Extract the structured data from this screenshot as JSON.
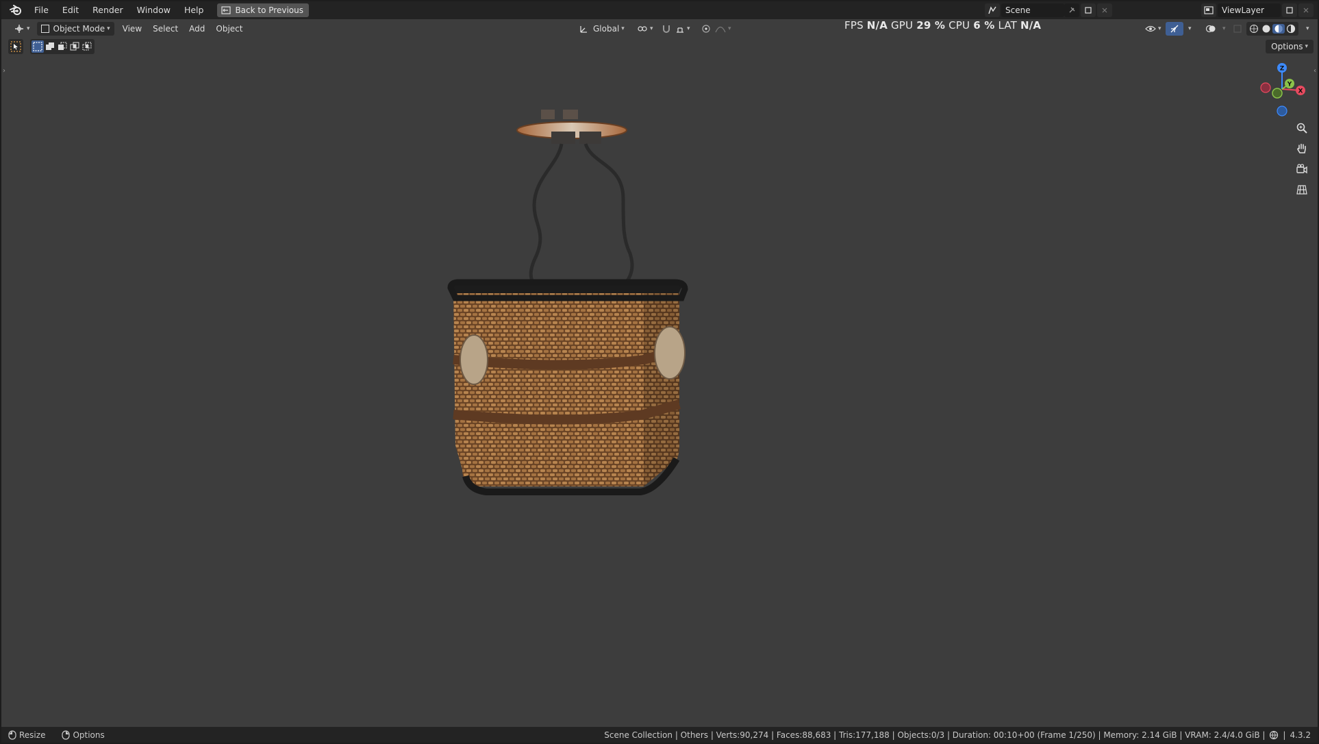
{
  "menu": {
    "items": [
      "File",
      "Edit",
      "Render",
      "Window",
      "Help"
    ],
    "back_button": "Back to Previous"
  },
  "scene": {
    "name": "Scene"
  },
  "view_layer": {
    "name": "ViewLayer"
  },
  "header": {
    "mode": "Object Mode",
    "view": "View",
    "select": "Select",
    "add": "Add",
    "object": "Object",
    "transform_orientation": "Global",
    "options": "Options"
  },
  "stats_overlay": {
    "fps_label": "FPS",
    "fps_value": "N/A",
    "gpu_label": "GPU",
    "gpu_value": "29 %",
    "cpu_label": "CPU",
    "cpu_value": "6 %",
    "lat_label": "LAT",
    "lat_value": "N/A"
  },
  "gizmo": {
    "x": "X",
    "y": "Y",
    "z": "Z"
  },
  "status": {
    "resize": "Resize",
    "options": "Options",
    "info": "Scene Collection | Others | Verts:90,274 | Faces:88,683 | Tris:177,188 | Objects:0/3 | Duration: 00:10+00 (Frame 1/250) | Memory: 2.14 GiB | VRAM: 2.4/4.0 GiB |",
    "version": "4.3.2"
  },
  "colors": {
    "viewport_bg": "#3d3d3d",
    "bar_bg": "#232323",
    "axis_x": "#e84a5f",
    "axis_y": "#8bc34a",
    "axis_z": "#3d8bff"
  }
}
